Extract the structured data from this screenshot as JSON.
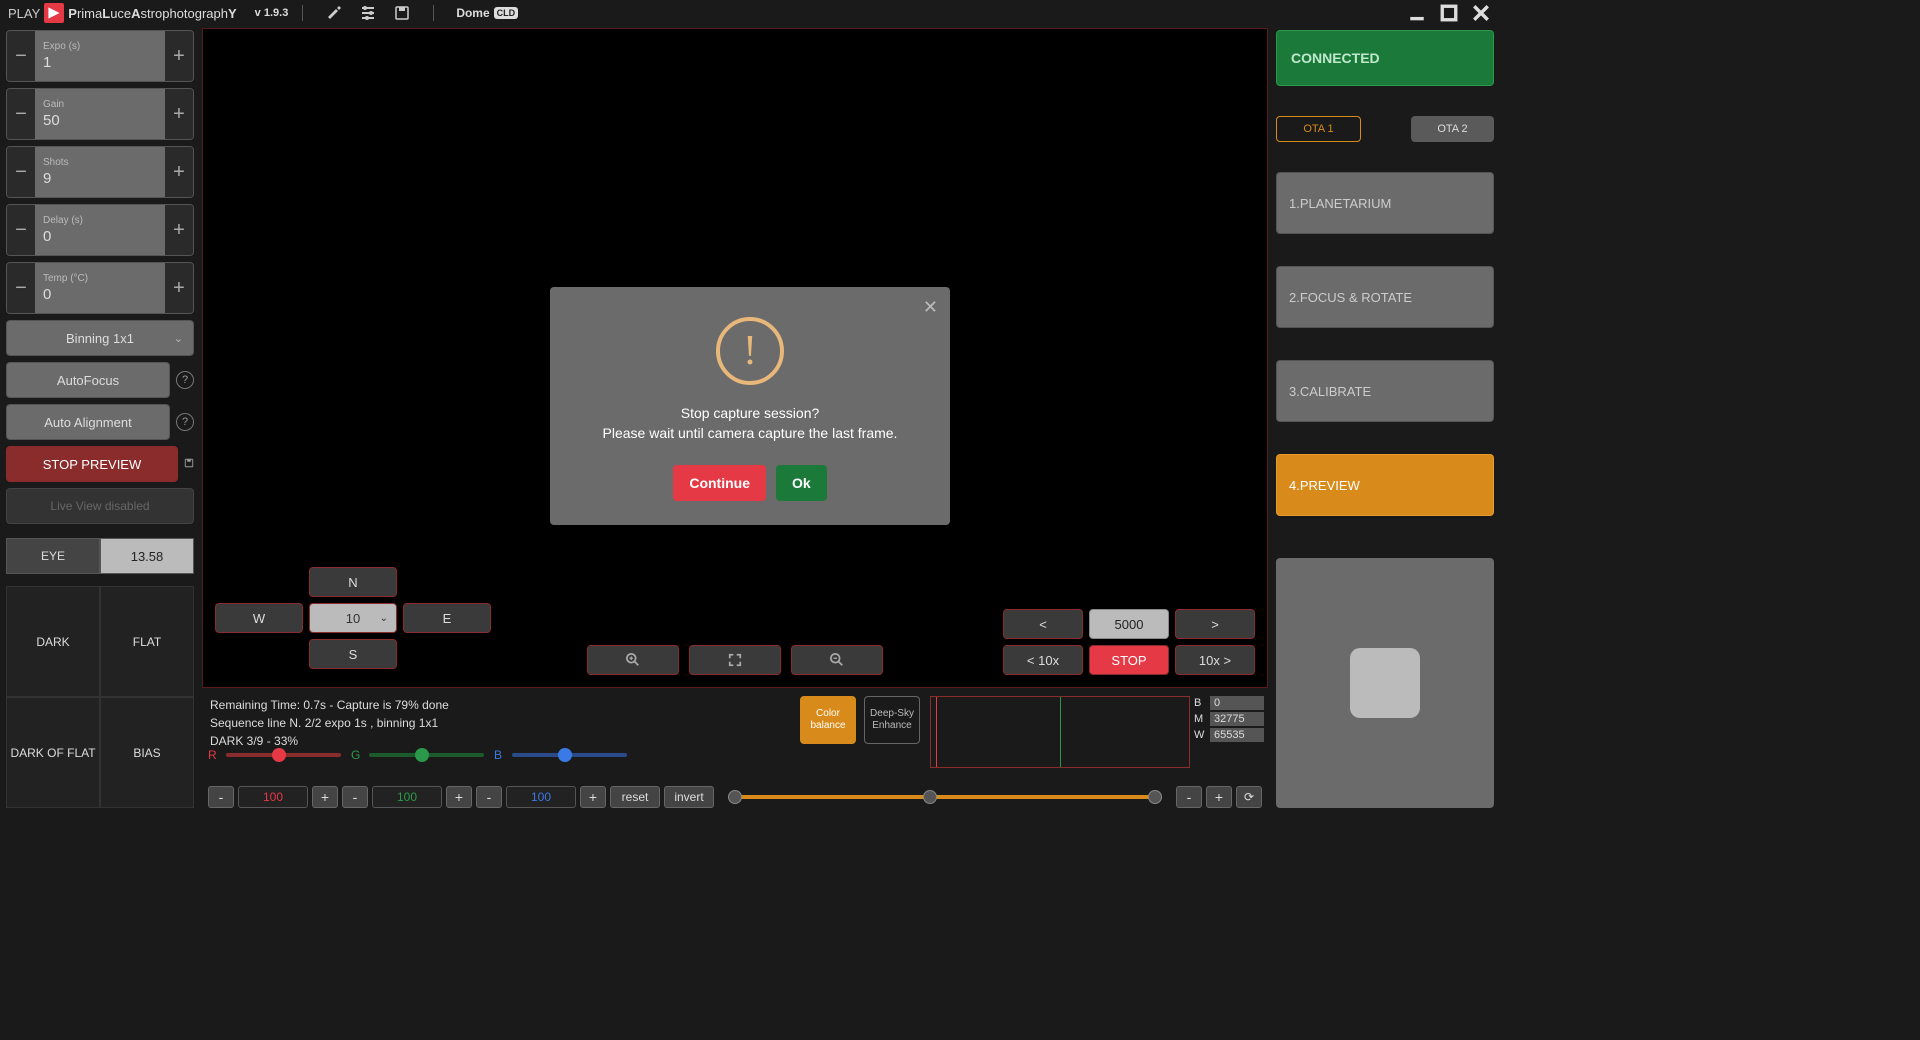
{
  "title": {
    "play": "PLAY",
    "brand": "PrimaLuceAstrophotographY",
    "version": "v 1.9.3",
    "dome": "Dome",
    "cld": "CLD"
  },
  "left": {
    "expo": {
      "label": "Expo (s)",
      "value": "1"
    },
    "gain": {
      "label": "Gain",
      "value": "50"
    },
    "shots": {
      "label": "Shots",
      "value": "9"
    },
    "delay": {
      "label": "Delay (s)",
      "value": "0"
    },
    "temp": {
      "label": "Temp (°C)",
      "value": "0"
    },
    "binning": "Binning 1x1",
    "autofocus": "AutoFocus",
    "autoalign": "Auto Alignment",
    "stop_preview": "STOP PREVIEW",
    "live_disabled": "Live View disabled",
    "eye": "EYE",
    "eye_val": "13.58",
    "dark": "DARK",
    "flat": "FLAT",
    "darkflat": "DARK OF FLAT",
    "bias": "BIAS"
  },
  "nav": {
    "n": "N",
    "s": "S",
    "e": "E",
    "w": "W",
    "speed": "10"
  },
  "rot": {
    "lt": "<",
    "val": "5000",
    "gt": ">",
    "lt10": "< 10x",
    "stop": "STOP",
    "gt10": "10x >"
  },
  "status": {
    "line1": "Remaining Time: 0.7s  -  Capture is 79% done",
    "line2": "Sequence line N. 2/2 expo 1s , binning 1x1",
    "line3": "DARK 3/9 - 33%"
  },
  "toggles": {
    "color_balance": "Color balance",
    "deep_sky": "Deep-Sky Enhance"
  },
  "bwm": {
    "b": "0",
    "m": "32775",
    "w": "65535"
  },
  "rgb": {
    "r": "100",
    "g": "100",
    "b": "100",
    "reset": "reset",
    "invert": "invert"
  },
  "right": {
    "connected": "CONNECTED",
    "ota1": "OTA 1",
    "ota2": "OTA 2",
    "s1": "1.PLANETARIUM",
    "s2": "2.FOCUS & ROTATE",
    "s3": "3.CALIBRATE",
    "s4": "4.PREVIEW"
  },
  "modal": {
    "line1": "Stop capture session?",
    "line2": "Please wait until camera capture the last frame.",
    "continue": "Continue",
    "ok": "Ok"
  }
}
